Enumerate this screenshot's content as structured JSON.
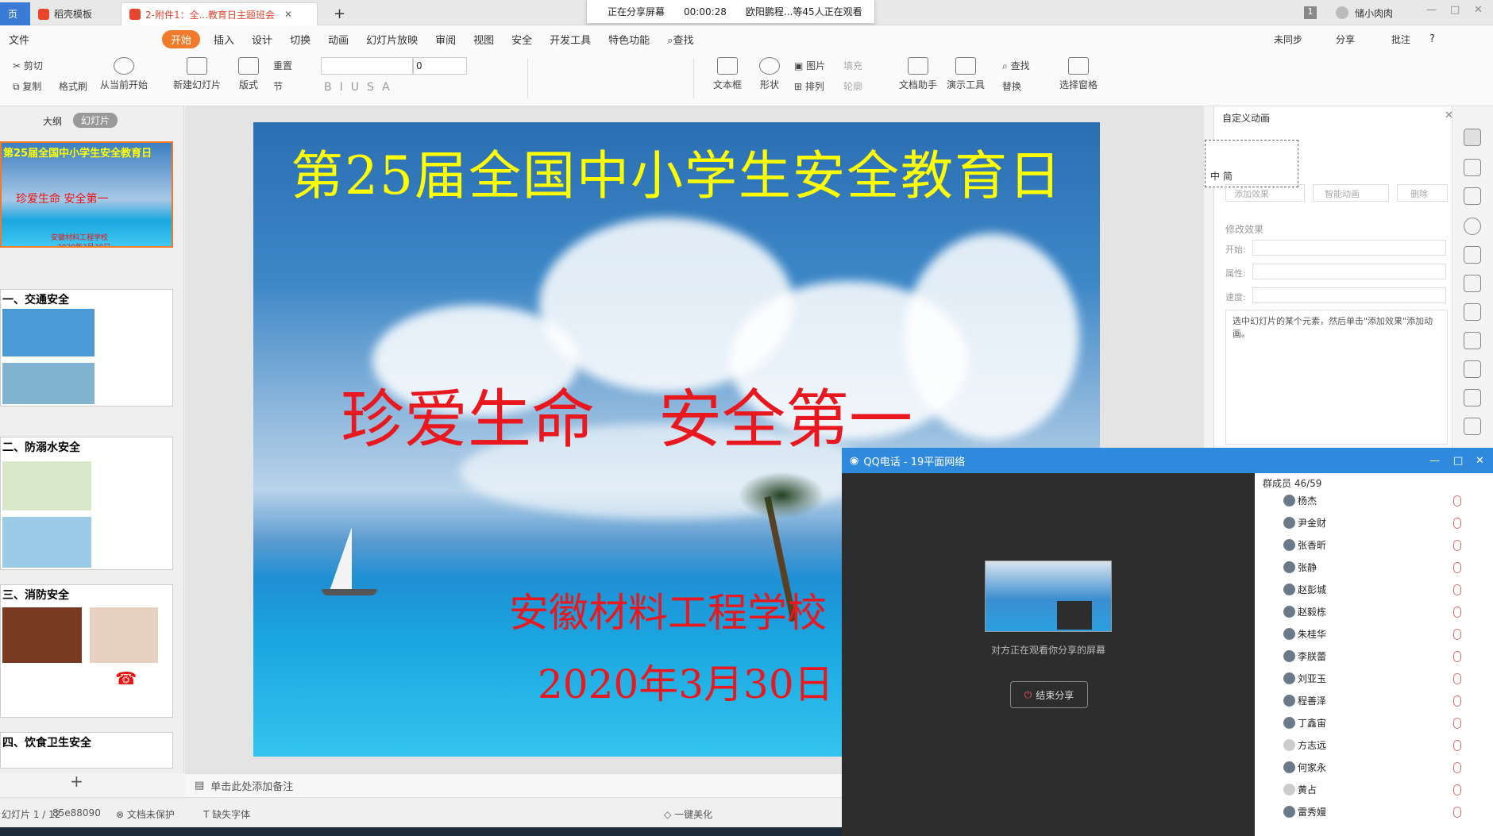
{
  "tabs": [
    "稻壳模板",
    "2-附件1：全...教育日主题班会"
  ],
  "share_bar": {
    "status": "正在分享屏幕",
    "timer": "00:00:28",
    "viewers": "欧阳鹏程...等45人正在观看"
  },
  "window": {
    "badge": "1",
    "user": "储小肉肉"
  },
  "menu": [
    "文件",
    "开始",
    "插入",
    "设计",
    "切换",
    "动画",
    "幻灯片放映",
    "审阅",
    "视图",
    "安全",
    "开发工具",
    "特色功能",
    "查找"
  ],
  "menu_right": [
    "未同步",
    "分享",
    "批注",
    "?"
  ],
  "ribbon": {
    "cut": "剪切",
    "copy": "复制",
    "format": "格式刷",
    "from_current": "从当前开始",
    "new_slide": "新建幻灯片",
    "layout": "版式",
    "reset": "重置",
    "section": "节",
    "font_size": "0",
    "textbox": "文本框",
    "shape": "形状",
    "picture": "图片",
    "arrange": "排列",
    "fill": "填充",
    "outline": "轮廓",
    "doc_assistant": "文档助手",
    "present_tools": "演示工具",
    "find": "查找",
    "replace": "替换",
    "select_pane": "选择窗格"
  },
  "left_tabs": [
    "大纲",
    "幻灯片"
  ],
  "thumbs": [
    {
      "title": "第25届全国中小学生安全教育日",
      "sub": "珍爱生命 安全第一",
      "school": "安徽材料工程学校",
      "date": "2020年3月30日"
    },
    {
      "title": "一、交通安全"
    },
    {
      "title": "二、防溺水安全"
    },
    {
      "title": "三、消防安全"
    },
    {
      "title": "四、饮食卫生安全"
    }
  ],
  "slide": {
    "title": "第25届全国中小学生安全教育日",
    "motto": "珍爱生命　安全第一",
    "school": "安徽材料工程学校",
    "date": "2020年3月30日"
  },
  "notes_placeholder": "单击此处添加备注",
  "status": {
    "page": "幻灯片 1 / 12",
    "id": "85e88090",
    "protect": "文档未保护",
    "font": "缺失字体",
    "beautify": "一键美化"
  },
  "anim_pane": {
    "title": "自定义动画",
    "add": "添加效果",
    "smart": "智能动画",
    "delete": "删除",
    "modify": "修改效果",
    "start": "开始:",
    "prop": "属性:",
    "speed": "速度:",
    "hint": "选中幻灯片的某个元素，然后单击\"添加效果\"添加动画。",
    "chars": "中 简"
  },
  "qq": {
    "title": "QQ电话 - 19平面网络",
    "watching": "对方正在观看你分享的屏幕",
    "end": "结束分享",
    "members_label": "群成员 46/59",
    "members": [
      "杨杰",
      "尹金财",
      "张香昕",
      "张静",
      "赵彭城",
      "赵毅栋",
      "朱桂华",
      "李朕蕾",
      "刘亚玉",
      "程善泽",
      "丁鑫宙",
      "方志远",
      "何家永",
      "黄占",
      "雷秀嫚"
    ]
  }
}
